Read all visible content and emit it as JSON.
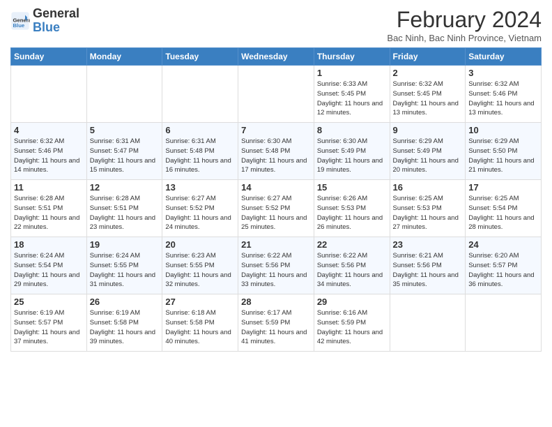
{
  "header": {
    "logo_line1": "General",
    "logo_line2": "Blue",
    "month_title": "February 2024",
    "location": "Bac Ninh, Bac Ninh Province, Vietnam"
  },
  "days_of_week": [
    "Sunday",
    "Monday",
    "Tuesday",
    "Wednesday",
    "Thursday",
    "Friday",
    "Saturday"
  ],
  "weeks": [
    [
      {
        "day": "",
        "info": ""
      },
      {
        "day": "",
        "info": ""
      },
      {
        "day": "",
        "info": ""
      },
      {
        "day": "",
        "info": ""
      },
      {
        "day": "1",
        "info": "Sunrise: 6:33 AM\nSunset: 5:45 PM\nDaylight: 11 hours and 12 minutes."
      },
      {
        "day": "2",
        "info": "Sunrise: 6:32 AM\nSunset: 5:45 PM\nDaylight: 11 hours and 13 minutes."
      },
      {
        "day": "3",
        "info": "Sunrise: 6:32 AM\nSunset: 5:46 PM\nDaylight: 11 hours and 13 minutes."
      }
    ],
    [
      {
        "day": "4",
        "info": "Sunrise: 6:32 AM\nSunset: 5:46 PM\nDaylight: 11 hours and 14 minutes."
      },
      {
        "day": "5",
        "info": "Sunrise: 6:31 AM\nSunset: 5:47 PM\nDaylight: 11 hours and 15 minutes."
      },
      {
        "day": "6",
        "info": "Sunrise: 6:31 AM\nSunset: 5:48 PM\nDaylight: 11 hours and 16 minutes."
      },
      {
        "day": "7",
        "info": "Sunrise: 6:30 AM\nSunset: 5:48 PM\nDaylight: 11 hours and 17 minutes."
      },
      {
        "day": "8",
        "info": "Sunrise: 6:30 AM\nSunset: 5:49 PM\nDaylight: 11 hours and 19 minutes."
      },
      {
        "day": "9",
        "info": "Sunrise: 6:29 AM\nSunset: 5:49 PM\nDaylight: 11 hours and 20 minutes."
      },
      {
        "day": "10",
        "info": "Sunrise: 6:29 AM\nSunset: 5:50 PM\nDaylight: 11 hours and 21 minutes."
      }
    ],
    [
      {
        "day": "11",
        "info": "Sunrise: 6:28 AM\nSunset: 5:51 PM\nDaylight: 11 hours and 22 minutes."
      },
      {
        "day": "12",
        "info": "Sunrise: 6:28 AM\nSunset: 5:51 PM\nDaylight: 11 hours and 23 minutes."
      },
      {
        "day": "13",
        "info": "Sunrise: 6:27 AM\nSunset: 5:52 PM\nDaylight: 11 hours and 24 minutes."
      },
      {
        "day": "14",
        "info": "Sunrise: 6:27 AM\nSunset: 5:52 PM\nDaylight: 11 hours and 25 minutes."
      },
      {
        "day": "15",
        "info": "Sunrise: 6:26 AM\nSunset: 5:53 PM\nDaylight: 11 hours and 26 minutes."
      },
      {
        "day": "16",
        "info": "Sunrise: 6:25 AM\nSunset: 5:53 PM\nDaylight: 11 hours and 27 minutes."
      },
      {
        "day": "17",
        "info": "Sunrise: 6:25 AM\nSunset: 5:54 PM\nDaylight: 11 hours and 28 minutes."
      }
    ],
    [
      {
        "day": "18",
        "info": "Sunrise: 6:24 AM\nSunset: 5:54 PM\nDaylight: 11 hours and 29 minutes."
      },
      {
        "day": "19",
        "info": "Sunrise: 6:24 AM\nSunset: 5:55 PM\nDaylight: 11 hours and 31 minutes."
      },
      {
        "day": "20",
        "info": "Sunrise: 6:23 AM\nSunset: 5:55 PM\nDaylight: 11 hours and 32 minutes."
      },
      {
        "day": "21",
        "info": "Sunrise: 6:22 AM\nSunset: 5:56 PM\nDaylight: 11 hours and 33 minutes."
      },
      {
        "day": "22",
        "info": "Sunrise: 6:22 AM\nSunset: 5:56 PM\nDaylight: 11 hours and 34 minutes."
      },
      {
        "day": "23",
        "info": "Sunrise: 6:21 AM\nSunset: 5:56 PM\nDaylight: 11 hours and 35 minutes."
      },
      {
        "day": "24",
        "info": "Sunrise: 6:20 AM\nSunset: 5:57 PM\nDaylight: 11 hours and 36 minutes."
      }
    ],
    [
      {
        "day": "25",
        "info": "Sunrise: 6:19 AM\nSunset: 5:57 PM\nDaylight: 11 hours and 37 minutes."
      },
      {
        "day": "26",
        "info": "Sunrise: 6:19 AM\nSunset: 5:58 PM\nDaylight: 11 hours and 39 minutes."
      },
      {
        "day": "27",
        "info": "Sunrise: 6:18 AM\nSunset: 5:58 PM\nDaylight: 11 hours and 40 minutes."
      },
      {
        "day": "28",
        "info": "Sunrise: 6:17 AM\nSunset: 5:59 PM\nDaylight: 11 hours and 41 minutes."
      },
      {
        "day": "29",
        "info": "Sunrise: 6:16 AM\nSunset: 5:59 PM\nDaylight: 11 hours and 42 minutes."
      },
      {
        "day": "",
        "info": ""
      },
      {
        "day": "",
        "info": ""
      }
    ]
  ]
}
